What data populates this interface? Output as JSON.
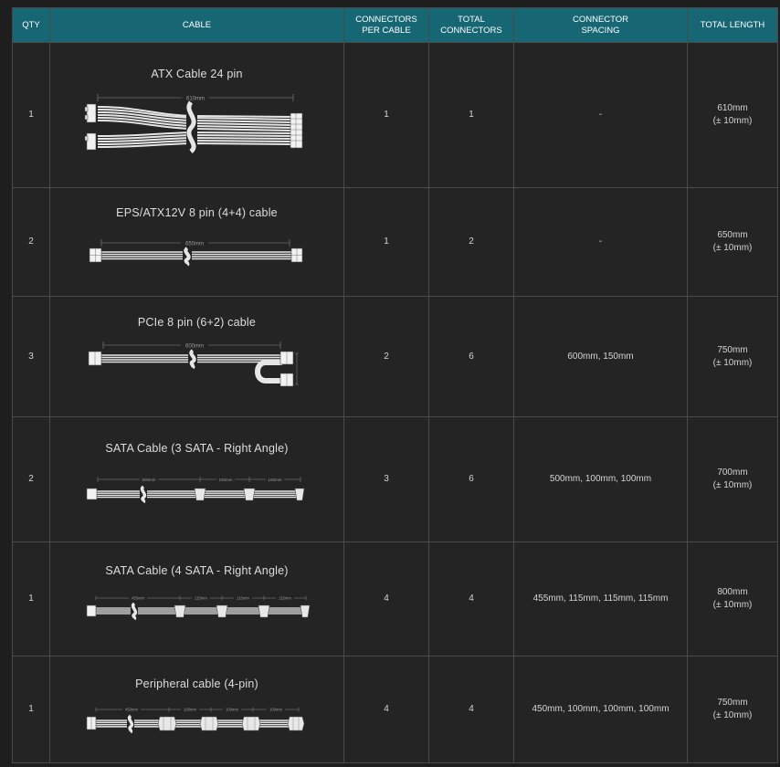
{
  "columns": {
    "qty": "QTY",
    "cable": "CABLE",
    "connectors_per_cable": [
      "CONNECTORS",
      "PER CABLE"
    ],
    "total_connectors": [
      "TOTAL",
      "CONNECTORS"
    ],
    "connector_spacing": [
      "CONNECTOR",
      "SPACING"
    ],
    "total_length": "TOTAL LENGTH"
  },
  "rows": [
    {
      "qty": "1",
      "cable": "ATX Cable 24 pin",
      "per_cable": "1",
      "total": "1",
      "spacing": "-",
      "length": "610mm",
      "tolerance": "(± 10mm)",
      "dims": [
        "610mm"
      ]
    },
    {
      "qty": "2",
      "cable": "EPS/ATX12V 8 pin (4+4) cable",
      "per_cable": "1",
      "total": "2",
      "spacing": "-",
      "length": "650mm",
      "tolerance": "(± 10mm)",
      "dims": [
        "650mm"
      ]
    },
    {
      "qty": "3",
      "cable": "PCIe 8 pin (6+2) cable",
      "per_cable": "2",
      "total": "6",
      "spacing": "600mm, 150mm",
      "length": "750mm",
      "tolerance": "(± 10mm)",
      "dims": [
        "600mm"
      ]
    },
    {
      "qty": "2",
      "cable": "SATA Cable (3 SATA - Right Angle)",
      "per_cable": "3",
      "total": "6",
      "spacing": "500mm, 100mm, 100mm",
      "length": "700mm",
      "tolerance": "(± 10mm)",
      "dims": [
        "500mm",
        "100mm",
        "100mm"
      ]
    },
    {
      "qty": "1",
      "cable": "SATA Cable (4 SATA - Right Angle)",
      "per_cable": "4",
      "total": "4",
      "spacing": "455mm, 115mm, 115mm, 115mm",
      "length": "800mm",
      "tolerance": "(± 10mm)",
      "dims": [
        "455mm",
        "115mm",
        "115mm",
        "115mm"
      ]
    },
    {
      "qty": "1",
      "cable": "Peripheral cable (4-pin)",
      "per_cable": "4",
      "total": "4",
      "spacing": "450mm, 100mm, 100mm, 100mm",
      "length": "750mm",
      "tolerance": "(± 10mm)",
      "dims": [
        "450mm",
        "100mm",
        "100mm",
        "100mm"
      ]
    }
  ],
  "colors": {
    "header_bg": "#176674",
    "header_text": "#ffffff",
    "row_bg": "#242424",
    "border": "#4a4a4a",
    "cable": "#e6e6e6"
  }
}
